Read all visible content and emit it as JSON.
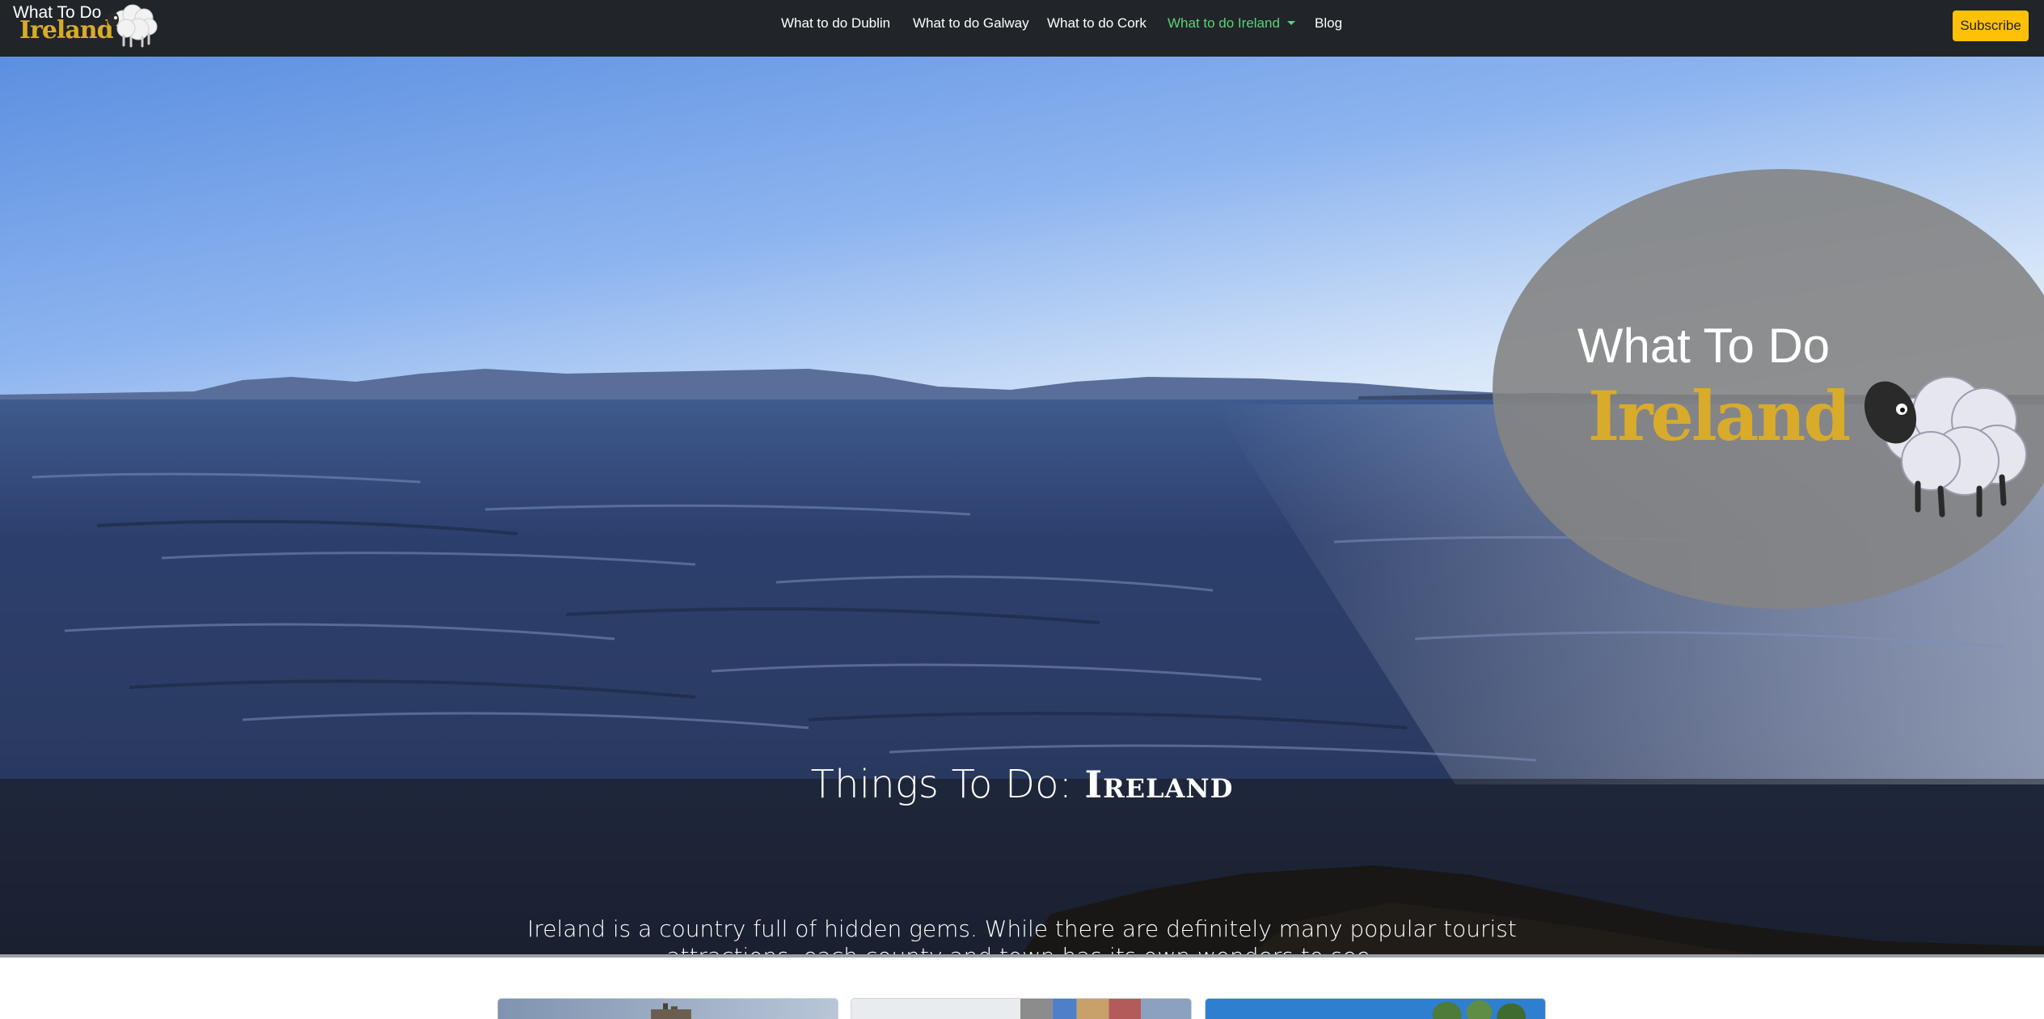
{
  "brand": {
    "line1": "What To Do",
    "line2": "Ireland",
    "icon": "sheep-icon"
  },
  "nav": {
    "items": [
      {
        "label": "What to do Dublin"
      },
      {
        "label": "What to do Galway"
      },
      {
        "label": "What to do Cork"
      },
      {
        "label": "What to do Ireland",
        "active": true,
        "dropdown": true
      },
      {
        "label": "Blog"
      }
    ],
    "subscribe_label": "Subscribe"
  },
  "hero": {
    "logo_line1": "What To Do",
    "logo_line2": "Ireland",
    "title_prefix": "Things To Do:",
    "title_place": "Ireland",
    "text": "Ireland is a country full of hidden gems. While there are definitely many popular tourist attractions, each county and town has its own wonders to see."
  },
  "cards": [
    {
      "image": "cathedral-photo"
    },
    {
      "image": "colourful-street-photo"
    },
    {
      "image": "tree-photo"
    }
  ],
  "colors": {
    "navbar": "#212529",
    "brand_gold": "#d9ab2b",
    "nav_active": "#5cd17a",
    "subscribe": "#ffc107"
  }
}
